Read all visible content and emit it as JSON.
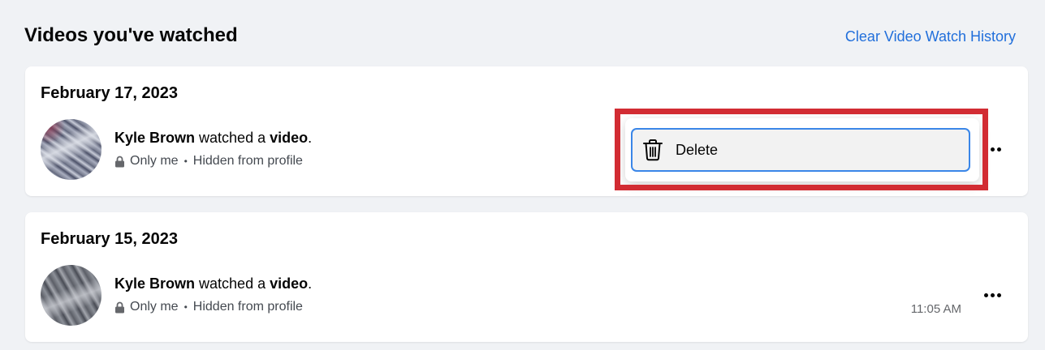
{
  "header": {
    "title": "Videos you've watched",
    "clear_link": "Clear Video Watch History"
  },
  "entries": [
    {
      "date": "February 17, 2023",
      "actor": "Kyle Brown",
      "action": " watched a ",
      "object": "video",
      "end": ".",
      "privacy": "Only me",
      "separator": "•",
      "visibility": "Hidden from profile",
      "time": ""
    },
    {
      "date": "February 15, 2023",
      "actor": "Kyle Brown",
      "action": " watched a ",
      "object": "video",
      "end": ".",
      "privacy": "Only me",
      "separator": "•",
      "visibility": "Hidden from profile",
      "time": "11:05 AM"
    }
  ],
  "menu": {
    "delete_label": "Delete"
  },
  "icons": {
    "lock": "lock-icon",
    "more": "more-options-icon",
    "trash": "trash-icon"
  },
  "colors": {
    "link": "#216fdb",
    "highlight": "#d22c33",
    "focus_ring": "#3a86e8",
    "background": "#f0f2f5"
  }
}
